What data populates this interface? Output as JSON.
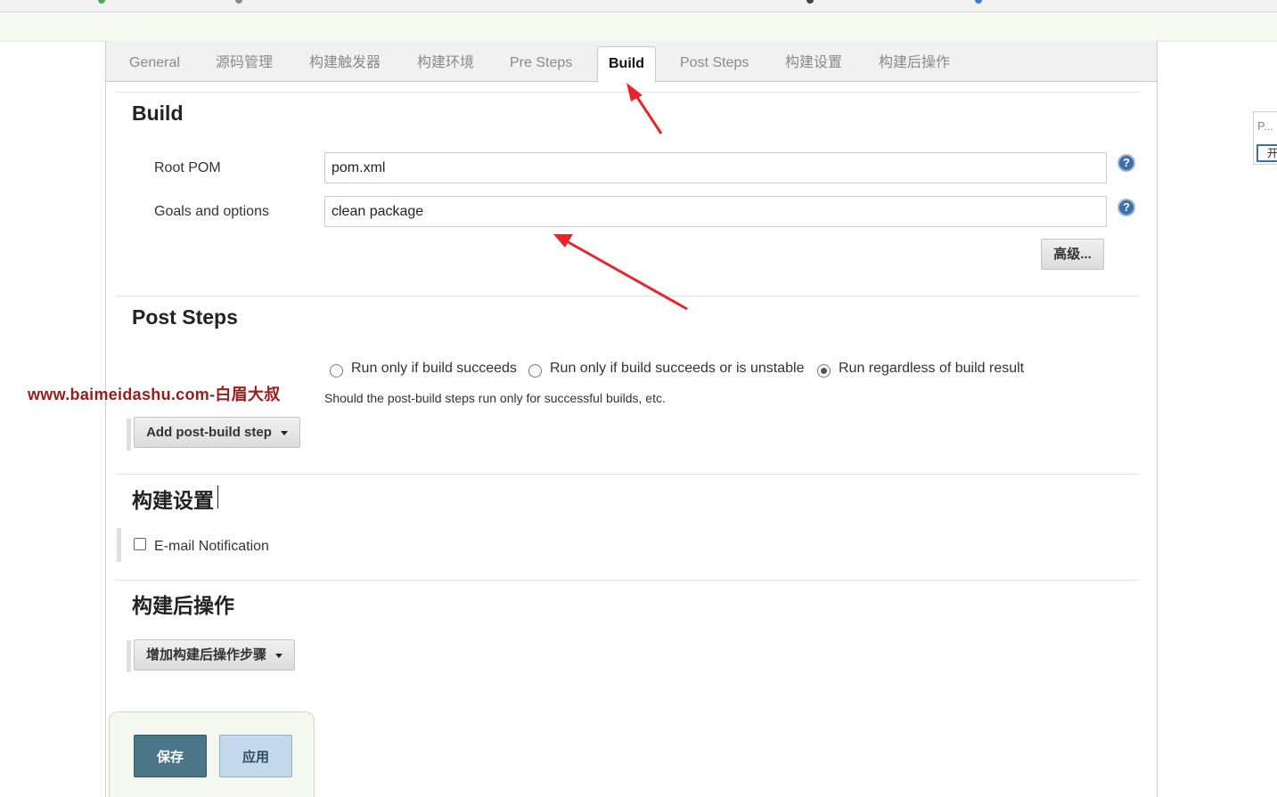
{
  "tabs": [
    {
      "label": "General",
      "active": false
    },
    {
      "label": "源码管理",
      "active": false
    },
    {
      "label": "构建触发器",
      "active": false
    },
    {
      "label": "构建环境",
      "active": false
    },
    {
      "label": "Pre Steps",
      "active": false
    },
    {
      "label": "Build",
      "active": true
    },
    {
      "label": "Post Steps",
      "active": false
    },
    {
      "label": "构建设置",
      "active": false
    },
    {
      "label": "构建后操作",
      "active": false
    }
  ],
  "build": {
    "title": "Build",
    "root_pom_label": "Root POM",
    "root_pom_value": "pom.xml",
    "goals_label": "Goals and options",
    "goals_value": "clean package",
    "advanced_button": "高级...",
    "help_icon": "question-circle-icon"
  },
  "post_steps": {
    "title": "Post Steps",
    "options": [
      {
        "label": "Run only if build succeeds",
        "checked": false
      },
      {
        "label": "Run only if build succeeds or is unstable",
        "checked": false
      },
      {
        "label": "Run regardless of build result",
        "checked": true
      }
    ],
    "description": "Should the post-build steps run only for successful builds, etc.",
    "add_button": "Add post-build step"
  },
  "build_settings": {
    "title": "构建设置",
    "email_label": "E-mail Notification",
    "email_checked": false
  },
  "post_build": {
    "title": "构建后操作",
    "add_button": "增加构建后操作步骤"
  },
  "actions": {
    "save": "保存",
    "apply": "应用"
  },
  "watermark": "www.baimeidashu.com-白眉大叔",
  "side_widget": {
    "text": "P...",
    "button": "开"
  },
  "colors": {
    "annotation_arrow": "#e8252b",
    "save_button": "#4a7688",
    "apply_button": "#c5d9ec",
    "help_icon": "#3d6fa8",
    "watermark": "#9b1a1a"
  }
}
